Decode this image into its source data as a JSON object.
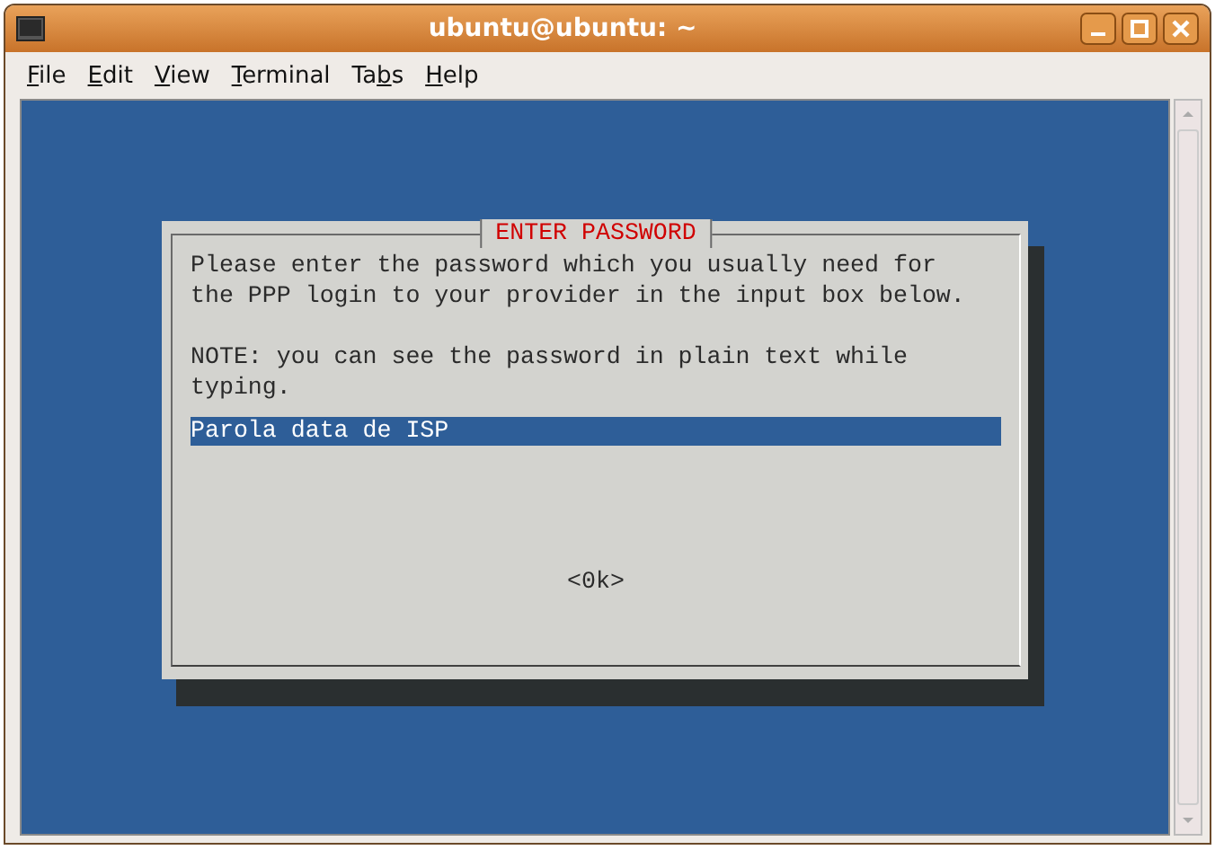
{
  "window": {
    "title": "ubuntu@ubuntu: ~"
  },
  "menu": [
    {
      "underlined": "F",
      "after": "ile"
    },
    {
      "underlined": "E",
      "after": "dit"
    },
    {
      "underlined": "V",
      "after": "iew"
    },
    {
      "underlined": "T",
      "after": "erminal"
    },
    {
      "before": "Ta",
      "underlined": "b",
      "after": "s"
    },
    {
      "underlined": "H",
      "after": "elp"
    }
  ],
  "dialog": {
    "title": "ENTER PASSWORD",
    "paragraphs": [
      [
        "Please enter the password which you usually need for",
        "the PPP login to your provider in the input box below."
      ],
      [
        "NOTE: you can see the password in plain text while",
        "typing."
      ]
    ],
    "input": {
      "value": "Parola data de ISP"
    },
    "buttons": [
      "<0k>"
    ]
  }
}
